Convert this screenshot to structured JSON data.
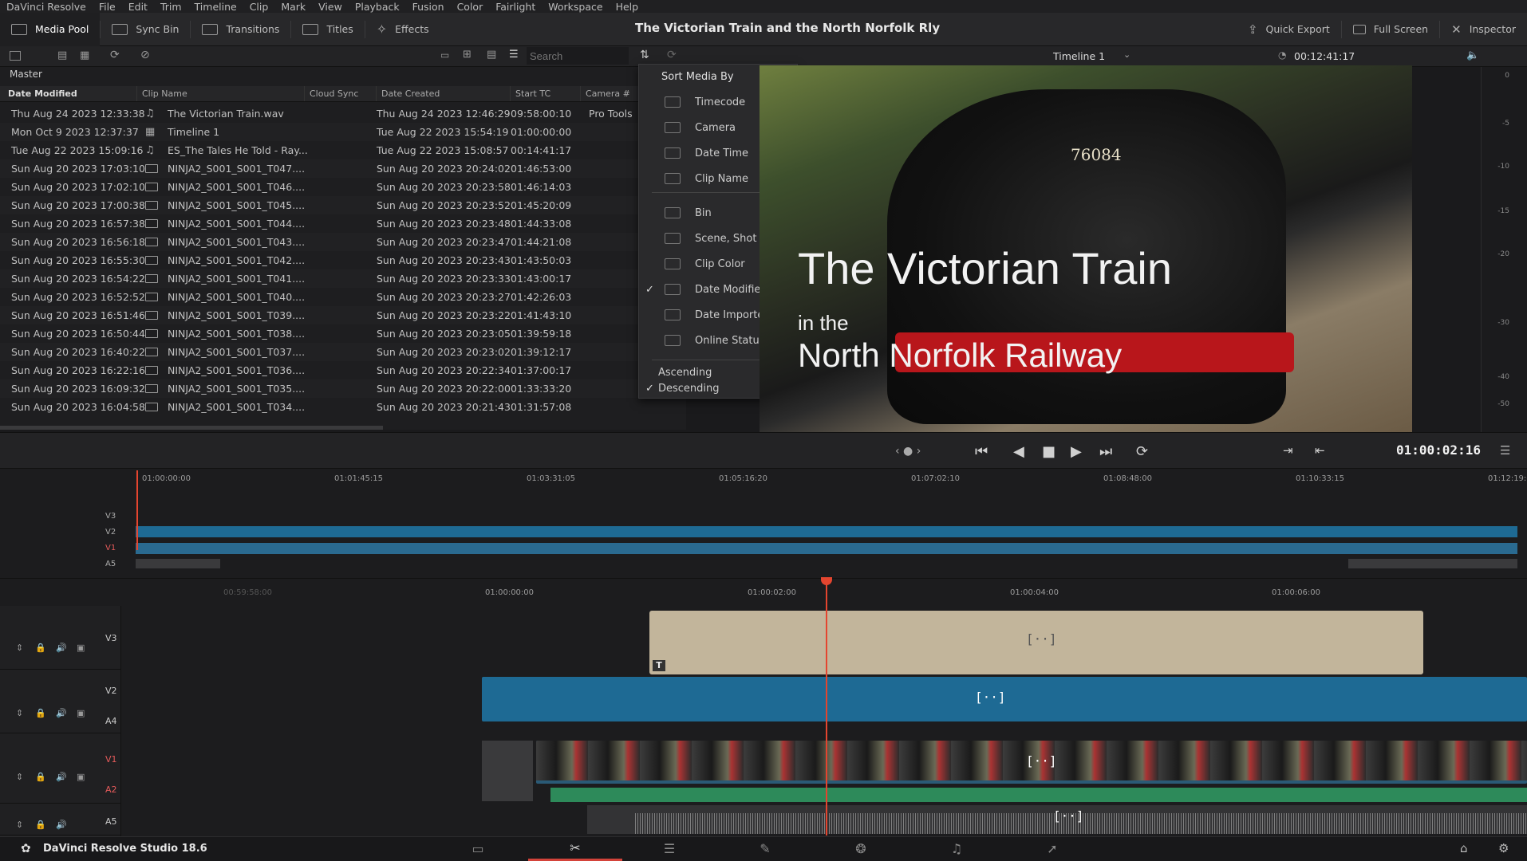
{
  "menu": [
    "DaVinci Resolve",
    "File",
    "Edit",
    "Trim",
    "Timeline",
    "Clip",
    "Mark",
    "View",
    "Playback",
    "Fusion",
    "Color",
    "Fairlight",
    "Workspace",
    "Help"
  ],
  "toolbar": {
    "media_pool": "Media Pool",
    "sync_bin": "Sync Bin",
    "transitions": "Transitions",
    "titles": "Titles",
    "effects": "Effects",
    "quick_export": "Quick Export",
    "full_screen": "Full Screen",
    "inspector": "Inspector"
  },
  "project_title": "The Victorian Train and the North Norfolk Rly",
  "search": {
    "placeholder": "Search"
  },
  "bin": "Master",
  "columns": [
    "Date Modified",
    "Clip Name",
    "Cloud Sync",
    "Date Created",
    "Start TC",
    "Camera #"
  ],
  "rows": [
    {
      "modified": "Thu Aug 24 2023 12:33:38",
      "icon": "audio",
      "name": "The Victorian Train.wav",
      "created": "Thu Aug 24 2023 12:46:29",
      "tc": "09:58:00:10",
      "cam": "Pro Tools"
    },
    {
      "modified": "Mon Oct 9 2023 12:37:37",
      "icon": "timeline",
      "name": "Timeline 1",
      "created": "Tue Aug 22 2023 15:54:19",
      "tc": "01:00:00:00",
      "cam": ""
    },
    {
      "modified": "Tue Aug 22 2023 15:09:16",
      "icon": "audio",
      "name": "ES_The Tales He Told - Ray...",
      "created": "Tue Aug 22 2023 15:08:57",
      "tc": "00:14:41:17",
      "cam": ""
    },
    {
      "modified": "Sun Aug 20 2023 17:03:10",
      "icon": "video",
      "name": "NINJA2_S001_S001_T047....",
      "created": "Sun Aug 20 2023 20:24:02",
      "tc": "01:46:53:00",
      "cam": ""
    },
    {
      "modified": "Sun Aug 20 2023 17:02:10",
      "icon": "video",
      "name": "NINJA2_S001_S001_T046....",
      "created": "Sun Aug 20 2023 20:23:58",
      "tc": "01:46:14:03",
      "cam": ""
    },
    {
      "modified": "Sun Aug 20 2023 17:00:38",
      "icon": "video",
      "name": "NINJA2_S001_S001_T045....",
      "created": "Sun Aug 20 2023 20:23:52",
      "tc": "01:45:20:09",
      "cam": ""
    },
    {
      "modified": "Sun Aug 20 2023 16:57:38",
      "icon": "video",
      "name": "NINJA2_S001_S001_T044....",
      "created": "Sun Aug 20 2023 20:23:48",
      "tc": "01:44:33:08",
      "cam": ""
    },
    {
      "modified": "Sun Aug 20 2023 16:56:18",
      "icon": "video",
      "name": "NINJA2_S001_S001_T043....",
      "created": "Sun Aug 20 2023 20:23:47",
      "tc": "01:44:21:08",
      "cam": ""
    },
    {
      "modified": "Sun Aug 20 2023 16:55:30",
      "icon": "video",
      "name": "NINJA2_S001_S001_T042....",
      "created": "Sun Aug 20 2023 20:23:43",
      "tc": "01:43:50:03",
      "cam": ""
    },
    {
      "modified": "Sun Aug 20 2023 16:54:22",
      "icon": "video",
      "name": "NINJA2_S001_S001_T041....",
      "created": "Sun Aug 20 2023 20:23:33",
      "tc": "01:43:00:17",
      "cam": ""
    },
    {
      "modified": "Sun Aug 20 2023 16:52:52",
      "icon": "video",
      "name": "NINJA2_S001_S001_T040....",
      "created": "Sun Aug 20 2023 20:23:27",
      "tc": "01:42:26:03",
      "cam": ""
    },
    {
      "modified": "Sun Aug 20 2023 16:51:46",
      "icon": "video",
      "name": "NINJA2_S001_S001_T039....",
      "created": "Sun Aug 20 2023 20:23:22",
      "tc": "01:41:43:10",
      "cam": ""
    },
    {
      "modified": "Sun Aug 20 2023 16:50:44",
      "icon": "video",
      "name": "NINJA2_S001_S001_T038....",
      "created": "Sun Aug 20 2023 20:23:05",
      "tc": "01:39:59:18",
      "cam": ""
    },
    {
      "modified": "Sun Aug 20 2023 16:40:22",
      "icon": "video",
      "name": "NINJA2_S001_S001_T037....",
      "created": "Sun Aug 20 2023 20:23:02",
      "tc": "01:39:12:17",
      "cam": ""
    },
    {
      "modified": "Sun Aug 20 2023 16:22:16",
      "icon": "video",
      "name": "NINJA2_S001_S001_T036....",
      "created": "Sun Aug 20 2023 20:22:34",
      "tc": "01:37:00:17",
      "cam": ""
    },
    {
      "modified": "Sun Aug 20 2023 16:09:32",
      "icon": "video",
      "name": "NINJA2_S001_S001_T035....",
      "created": "Sun Aug 20 2023 20:22:00",
      "tc": "01:33:33:20",
      "cam": ""
    },
    {
      "modified": "Sun Aug 20 2023 16:04:58",
      "icon": "video",
      "name": "NINJA2_S001_S001_T034....",
      "created": "Sun Aug 20 2023 20:21:43",
      "tc": "01:31:57:08",
      "cam": ""
    }
  ],
  "sort_menu": {
    "title": "Sort Media By",
    "items": [
      "Timecode",
      "Camera",
      "Date Time",
      "Clip Name",
      "Bin",
      "Scene, Shot",
      "Clip Color",
      "Date Modified",
      "Date Imported",
      "Online Status"
    ],
    "checked": "Date Modified",
    "order": [
      "Ascending",
      "Descending"
    ],
    "order_checked": "Descending"
  },
  "viewer": {
    "timeline_name": "Timeline 1",
    "duration": "00:12:41:17",
    "timecode": "01:00:02:16",
    "overlay_line1": "The Victorian Train",
    "overlay_line2": "in the",
    "overlay_line3": "North Norfolk Railway",
    "loco_number": "76084"
  },
  "meter_labels": [
    "0",
    "-5",
    "-10",
    "-15",
    "-20",
    "-30",
    "-40",
    "-50"
  ],
  "mini_ruler": [
    "01:00:00:00",
    "01:01:45:15",
    "01:03:31:05",
    "01:05:16:20",
    "01:07:02:10",
    "01:08:48:00",
    "01:10:33:15",
    "01:12:19:0"
  ],
  "mini_tracks": [
    "V3",
    "V2",
    "V1",
    "A5"
  ],
  "main_ruler": [
    "00:59:58:00",
    "01:00:00:00",
    "01:00:02:00",
    "01:00:04:00",
    "01:00:06:00"
  ],
  "tracks": [
    "V3",
    "V2",
    "A4",
    "V1",
    "A2",
    "A5"
  ],
  "status": "DaVinci Resolve Studio 18.6",
  "colors": {
    "playhead": "#e4452f",
    "title_clip": "#c2b59b",
    "video_clip": "#1e6a94",
    "audio_clip": "#2d8a5a",
    "active_page": "#d4433a"
  }
}
